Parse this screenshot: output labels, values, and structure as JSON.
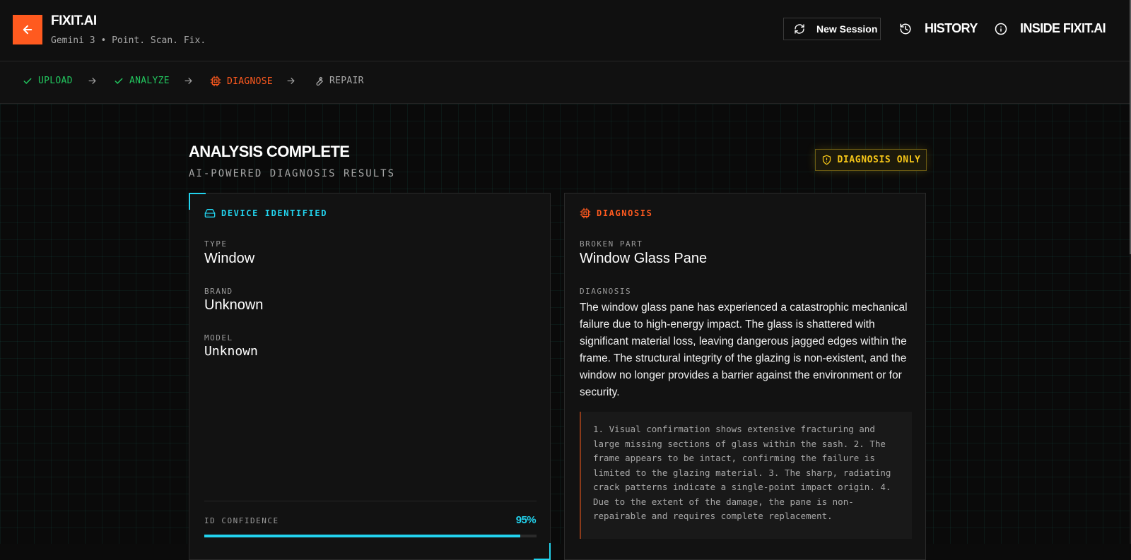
{
  "header": {
    "brand_title": "FIXIT.AI",
    "brand_subtitle": "Gemini 3 • Point. Scan. Fix.",
    "new_session_label": "New Session",
    "history_label": "HISTORY",
    "inside_label": "INSIDE FIXIT.AI"
  },
  "stepper": {
    "steps": [
      {
        "label": "UPLOAD",
        "state": "done",
        "icon": "check-icon"
      },
      {
        "label": "ANALYZE",
        "state": "done",
        "icon": "check-icon"
      },
      {
        "label": "DIAGNOSE",
        "state": "active",
        "icon": "chip-icon"
      },
      {
        "label": "REPAIR",
        "state": "pending",
        "icon": "wrench-icon"
      }
    ]
  },
  "page": {
    "title": "ANALYSIS COMPLETE",
    "subtitle": "AI-POWERED DIAGNOSIS RESULTS",
    "badge_label": "DIAGNOSIS ONLY"
  },
  "device": {
    "heading": "DEVICE IDENTIFIED",
    "type_label": "TYPE",
    "type_value": "Window",
    "brand_label": "BRAND",
    "brand_value": "Unknown",
    "model_label": "MODEL",
    "model_value": "Unknown",
    "confidence_label": "ID CONFIDENCE",
    "confidence_text": "95%",
    "confidence_fraction": 0.95
  },
  "diagnosis": {
    "heading": "DIAGNOSIS",
    "broken_part_label": "BROKEN PART",
    "broken_part_value": "Window Glass Pane",
    "diagnosis_label": "DIAGNOSIS",
    "diagnosis_text": "The window glass pane has experienced a catastrophic mechanical failure due to high-energy impact. The glass is shattered with significant material loss, leaving dangerous jagged edges within the frame. The structural integrity of the glazing is non-existent, and the window no longer provides a barrier against the environment or for security.",
    "notes_text": "1. Visual confirmation shows extensive fracturing and large missing sections of glass within the sash. 2. The frame appears to be intact, confirming the failure is limited to the glazing material. 3. The sharp, radiating crack patterns indicate a single-point impact origin. 4. Due to the extent of the damage, the pane is non-repairable and requires complete replacement."
  },
  "colors": {
    "accent_orange": "#ff5a1f",
    "done_green": "#22c55e",
    "cyan": "#22d3ee",
    "badge_yellow": "#f5c518"
  }
}
